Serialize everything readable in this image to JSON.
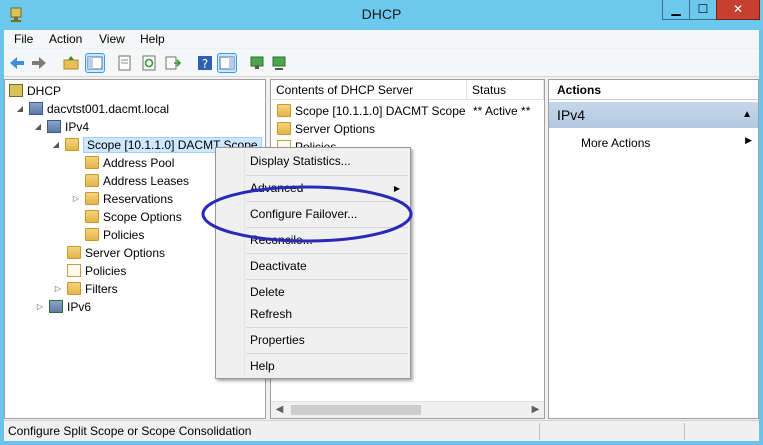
{
  "window": {
    "title": "DHCP"
  },
  "menu": [
    "File",
    "Action",
    "View",
    "Help"
  ],
  "tree": {
    "root": "DHCP",
    "server": "dacvtst001.dacmt.local",
    "ipv4": "IPv4",
    "scope": "Scope [10.1.1.0] DACMT Scope",
    "address_pool": "Address Pool",
    "address_leases": "Address Leases",
    "reservations": "Reservations",
    "scope_options": "Scope Options",
    "scope_policies": "Policies",
    "server_options": "Server Options",
    "policies": "Policies",
    "filters": "Filters",
    "ipv6": "IPv6"
  },
  "content": {
    "columns": [
      "Contents of DHCP Server",
      "Status"
    ],
    "rows": [
      {
        "name": "Scope [10.1.1.0] DACMT Scope",
        "status": "** Active **"
      },
      {
        "name": "Server Options",
        "status": ""
      },
      {
        "name": "Policies",
        "status": ""
      }
    ]
  },
  "actions": {
    "header": "Actions",
    "group": "IPv4",
    "items": [
      "More Actions"
    ]
  },
  "context_menu": {
    "items": [
      "Display Statistics...",
      "Advanced",
      "Configure Failover...",
      "Reconcile...",
      "Deactivate",
      "Delete",
      "Refresh",
      "Properties",
      "Help"
    ]
  },
  "status": {
    "text": "Configure Split Scope or Scope Consolidation"
  },
  "colors": {
    "titlebar": "#6dc8ee",
    "close": "#c7402f",
    "annotation": "#2a2ab8",
    "selection": "#cde8ff"
  }
}
